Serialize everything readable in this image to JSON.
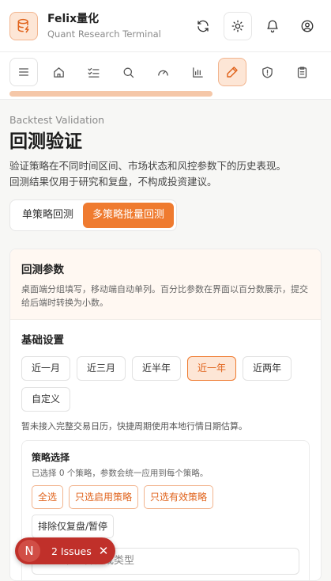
{
  "header": {
    "brand": "Felix量化",
    "subtitle": "Quant Research Terminal",
    "logo_icon": "database-bolt-icon",
    "actions": [
      "refresh-icon",
      "sun-icon",
      "bell-icon",
      "user-icon"
    ]
  },
  "nav": {
    "items": [
      "menu-icon",
      "home-icon",
      "checklist-icon",
      "search-icon",
      "gauge-icon",
      "bar-chart-icon",
      "pen-icon",
      "shield-alert-icon",
      "clipboard-icon"
    ],
    "active_index": 6
  },
  "page": {
    "eyebrow": "Backtest Validation",
    "title": "回测验证",
    "description_1": "验证策略在不同时间区间、市场状态和风控参数下的历史表现。",
    "description_2": "回测结果仅用于研究和复盘，不构成投资建议。"
  },
  "mode_tabs": {
    "single": "单策略回测",
    "batch": "多策略批量回测",
    "active": "batch"
  },
  "params_card": {
    "title": "回测参数",
    "description": "桌面端分组填写，移动端自动单列。百分比参数在界面以百分数展示，提交给后端时转换为小数。",
    "basic": {
      "title": "基础设置",
      "periods": [
        "近一月",
        "近三月",
        "近半年",
        "近一年",
        "近两年",
        "自定义"
      ],
      "active_period": "近一年",
      "note": "暂未接入完整交易日历，快捷周期使用本地行情日期估算。"
    },
    "strategy": {
      "title": "策略选择",
      "note": "已选择 0 个策略，参数会统一应用到每个策略。",
      "select_all": "全选",
      "select_enabled": "只选启用策略",
      "select_valid": "只选有效策略",
      "exclude_review": "排除仅复盘/暂停",
      "search_placeholder": "搜索策略名称或类型"
    }
  },
  "issues_badge": {
    "avatar": "N",
    "label": "2 Issues",
    "close": "✕"
  },
  "colors": {
    "accent": "#ef7b30",
    "accent_soft": "#fde6d6",
    "issues_red": "#c0302a"
  }
}
